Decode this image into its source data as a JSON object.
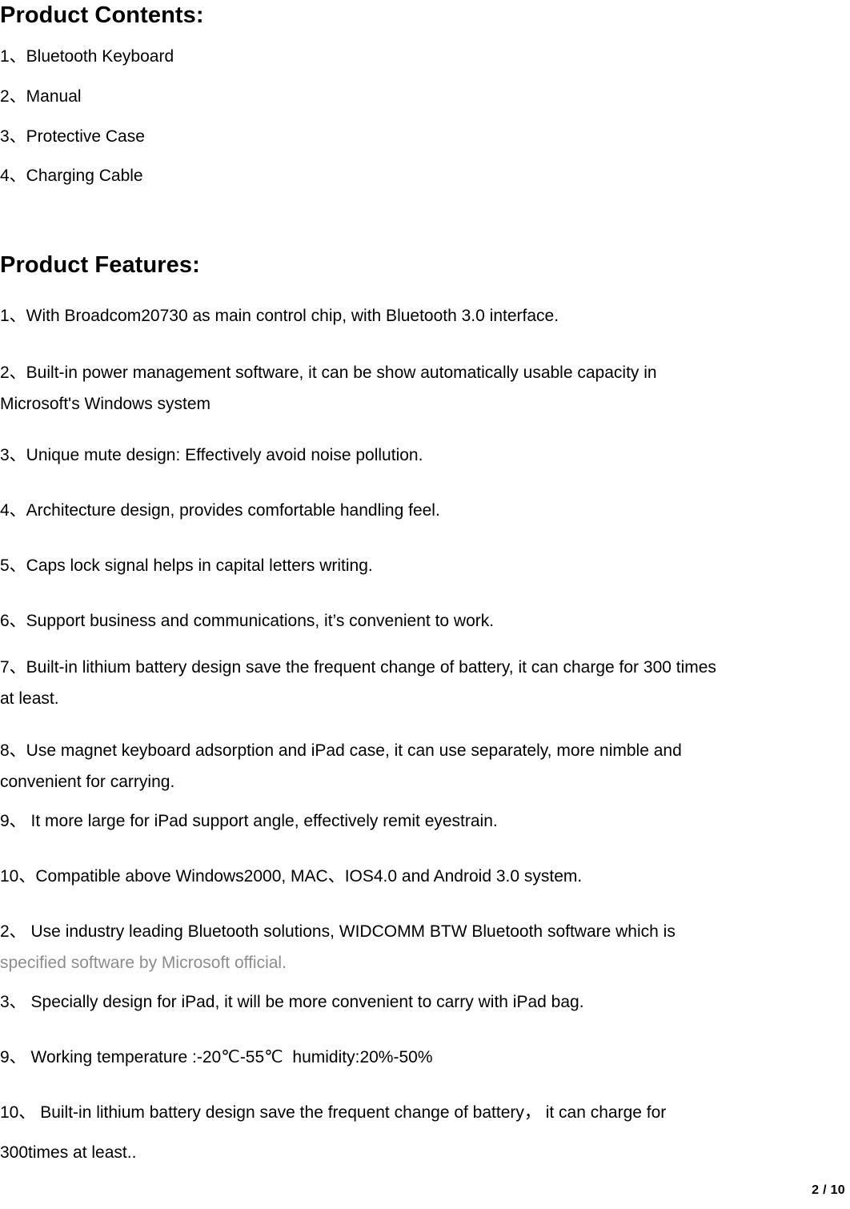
{
  "document": {
    "page_footer": "2 / 10",
    "colors": {
      "text": "#000000",
      "muted_text": "#8c8c8c",
      "background": "#ffffff"
    }
  },
  "sections": [
    {
      "id": "product-contents",
      "heading": "Product Contents:",
      "items": [
        "1、Bluetooth Keyboard",
        "2、Manual",
        "3、Protective Case",
        "4、Charging Cable"
      ]
    },
    {
      "id": "product-features",
      "heading": "Product Features:",
      "items": [
        "1、With Broadcom20730 as main control chip, with Bluetooth 3.0 interface.",
        "2、Built-in power management software, it can be show automatically usable capacity in\nMicrosoft's Windows system",
        "3、Unique mute design: Effectively avoid noise pollution.",
        "4、Architecture design, provides comfortable handling feel.",
        "5、Caps lock signal helps in capital letters writing.",
        "6、Support business and communications, it’s convenient to work.",
        "7、Built-in lithium battery design save the frequent change of battery, it can charge for 300 times\nat least.",
        "8、Use magnet keyboard adsorption and iPad case, it can use separately, more nimble and\nconvenient for carrying.",
        "9、 It more large for iPad support angle, effectively remit eyestrain.",
        "10、Compatible above Windows2000, MAC、IOS4.0 and Android 3.0 system."
      ]
    },
    {
      "id": "product-features-continued",
      "heading": "",
      "items": [
        "2、 Use industry leading Bluetooth solutions, WIDCOMM BTW Bluetooth software which is",
        "specified software by Microsoft official.",
        "3、 Specially design for iPad, it will be more convenient to carry with iPad bag.",
        "9、 Working temperature :-20℃-55℃  humidity:20%-50%",
        "10、 Built-in lithium battery design save the frequent change of battery， it can charge for\n300times at least.."
      ]
    }
  ],
  "lines": {
    "contents_heading": "Product Contents:",
    "contents_1": "1、Bluetooth Keyboard",
    "contents_2": "2、Manual",
    "contents_3": "3、Protective Case",
    "contents_4": "4、Charging Cable",
    "features_heading": "Product Features:",
    "f1": "1、With Broadcom20730 as main control chip, with Bluetooth 3.0 interface.",
    "f2a": "2、Built-in power management software, it can be show automatically usable capacity in",
    "f2b": "Microsoft's Windows system",
    "f3": "3、Unique mute design: Effectively avoid noise pollution.",
    "f4": "4、Architecture design, provides comfortable handling feel.",
    "f5": "5、Caps lock signal helps in capital letters writing.",
    "f6": "6、Support business and communications, it’s convenient to work.",
    "f7a": "7、Built-in lithium battery design save the frequent change of battery, it can charge for 300 times",
    "f7b": "at least.",
    "f8a": "8、Use magnet keyboard adsorption and iPad case, it can use separately, more nimble and",
    "f8b": "convenient for carrying.",
    "f9": "9、 It more large for iPad support angle, effectively remit eyestrain.",
    "f10": "10、Compatible above Windows2000, MAC、IOS4.0 and Android 3.0 system.",
    "g2a": "2、 Use industry leading Bluetooth solutions, WIDCOMM BTW Bluetooth software which is",
    "g2b": "specified software by Microsoft official.",
    "g3": "3、 Specially design for iPad, it will be more convenient to carry with iPad bag.",
    "g9": "9、 Working temperature :-20℃-55℃  humidity:20%-50%",
    "g10a": "10、 Built-in lithium battery design save the frequent change of battery， it can charge for",
    "g10b": "300times at least.."
  }
}
